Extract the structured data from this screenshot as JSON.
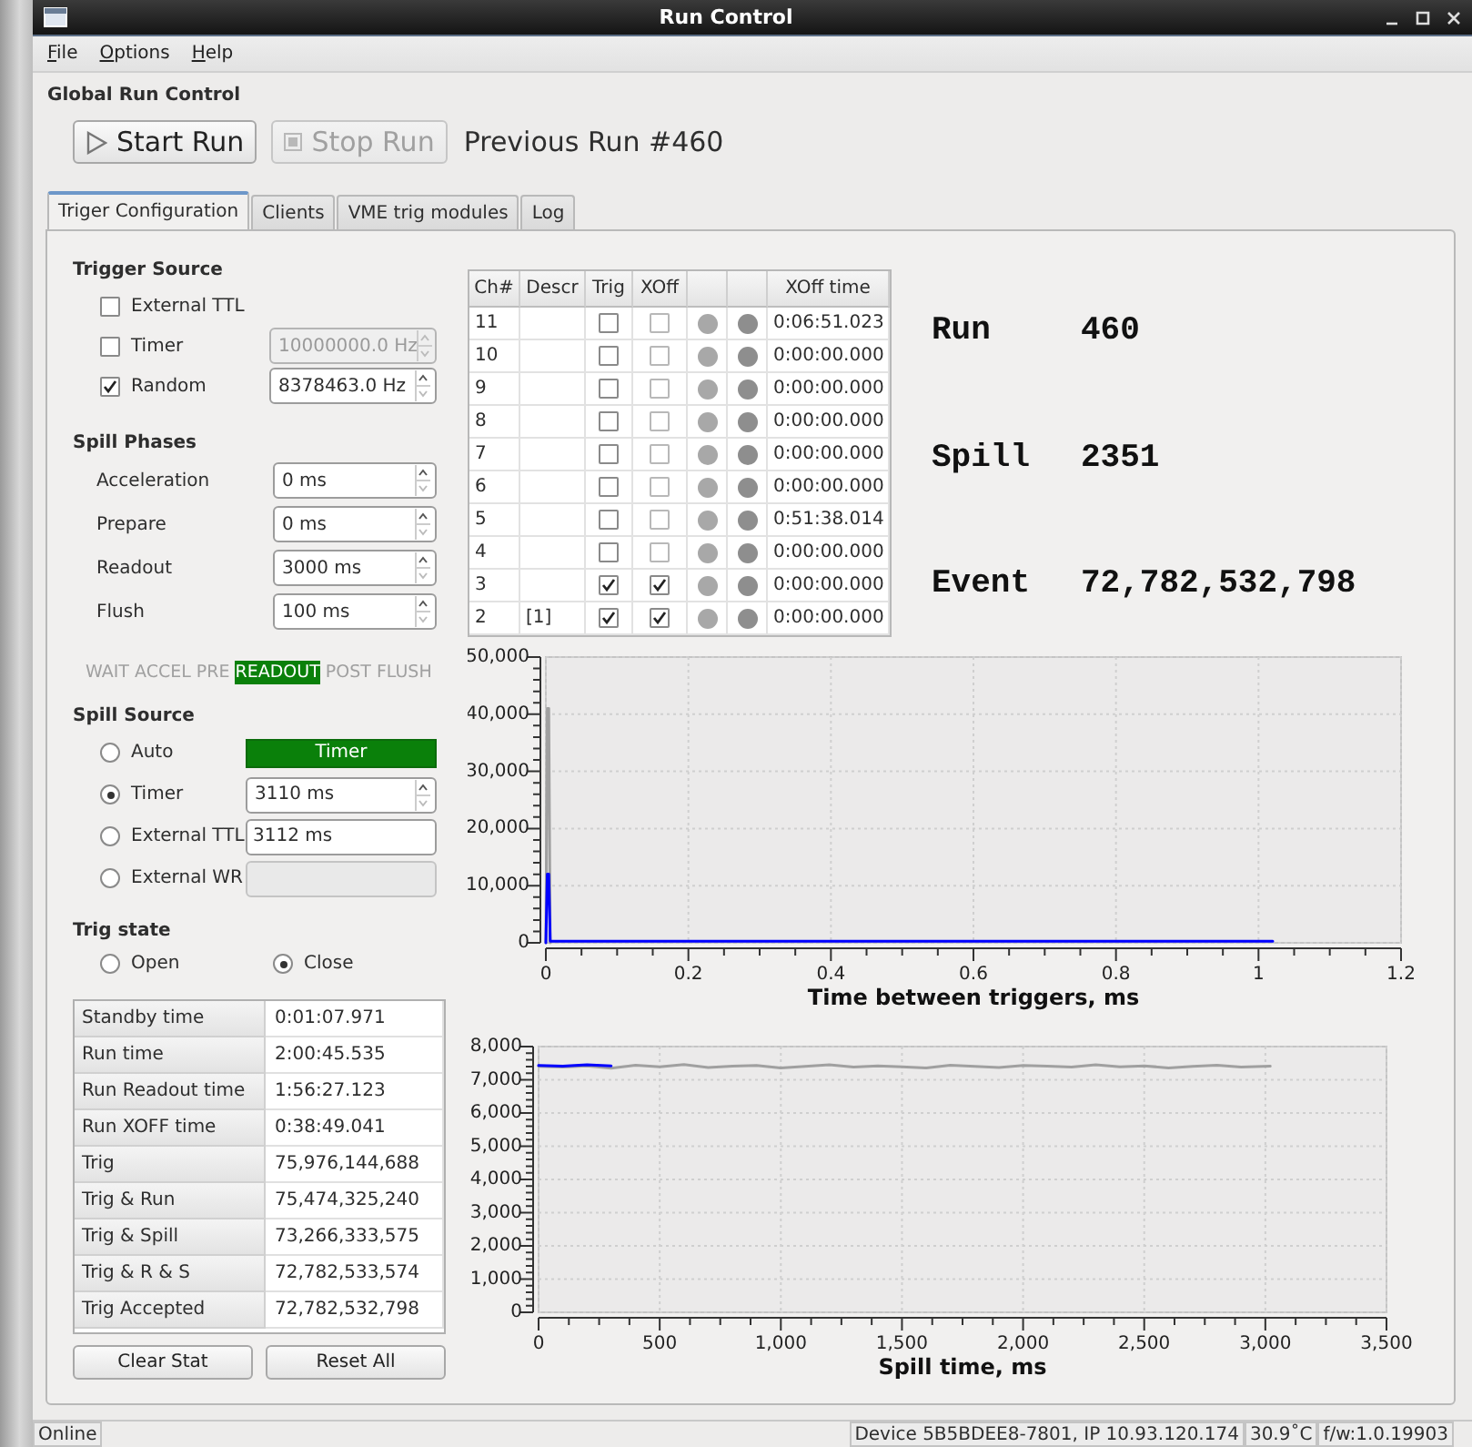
{
  "window": {
    "title": "Run Control"
  },
  "menu": [
    {
      "label": "File"
    },
    {
      "label": "Options"
    },
    {
      "label": "Help"
    }
  ],
  "global_run_control": {
    "title": "Global Run Control",
    "buttons": [
      {
        "label": "Start Run",
        "kind": "play",
        "disabled": false
      },
      {
        "label": "Stop Run",
        "kind": "stop",
        "disabled": true
      }
    ],
    "previous_run": "Previous Run #460"
  },
  "tabs": [
    {
      "label": "Triger Configuration",
      "selected": true
    },
    {
      "label": "Clients",
      "selected": false
    },
    {
      "label": "VME trig modules",
      "selected": false
    },
    {
      "label": "Log",
      "selected": false
    }
  ],
  "trigger_source": {
    "title": "Trigger Source",
    "items": [
      {
        "label": "External TTL",
        "checked": false
      },
      {
        "label": "Timer",
        "checked": false,
        "field": {
          "value": "10000000.0 Hz",
          "disabled": true
        }
      },
      {
        "label": "Random",
        "checked": true,
        "field": {
          "value": "8378463.0 Hz",
          "disabled": false
        }
      }
    ]
  },
  "spill_phases": {
    "title": "Spill Phases",
    "items": [
      {
        "label": "Acceleration",
        "value": "0 ms"
      },
      {
        "label": "Prepare",
        "value": "0 ms"
      },
      {
        "label": "Readout",
        "value": "3000 ms"
      },
      {
        "label": "Flush",
        "value": "100 ms"
      }
    ]
  },
  "phase_indicator": [
    {
      "label": "WAIT",
      "selected": false
    },
    {
      "label": "ACCEL",
      "selected": false
    },
    {
      "label": "PRE",
      "selected": false
    },
    {
      "label": "READOUT",
      "selected": true
    },
    {
      "label": "POST",
      "selected": false
    },
    {
      "label": "FLUSH",
      "selected": false
    }
  ],
  "spill_source": {
    "title": "Spill Source",
    "options": [
      {
        "label": "Auto",
        "selected": false,
        "kind": "indicator",
        "value": "Timer"
      },
      {
        "label": "Timer",
        "selected": true,
        "kind": "spin",
        "value": "3110 ms"
      },
      {
        "label": "External TTL",
        "selected": false,
        "kind": "text",
        "value": "3112 ms"
      },
      {
        "label": "External WR",
        "selected": false,
        "kind": "disabled"
      }
    ]
  },
  "trig_state": {
    "title": "Trig state",
    "options": [
      {
        "label": "Open",
        "selected": false
      },
      {
        "label": "Close",
        "selected": true
      }
    ]
  },
  "stats": [
    {
      "label": "Standby time",
      "value": "0:01:07.971"
    },
    {
      "label": "Run time",
      "value": "2:00:45.535"
    },
    {
      "label": "Run Readout time",
      "value": "1:56:27.123"
    },
    {
      "label": "Run XOFF time",
      "value": "0:38:49.041"
    },
    {
      "label": "Trig",
      "value": "75,976,144,688"
    },
    {
      "label": "Trig & Run",
      "value": "75,474,325,240"
    },
    {
      "label": "Trig & Spill",
      "value": "73,266,333,575"
    },
    {
      "label": "Trig & R & S",
      "value": "72,782,533,574"
    },
    {
      "label": "Trig Accepted",
      "value": "72,782,532,798"
    }
  ],
  "stat_buttons": [
    {
      "label": "Clear Stat"
    },
    {
      "label": "Reset All"
    }
  ],
  "channels": {
    "columns": [
      "Ch#",
      "Descr",
      "Trig",
      "XOff",
      "XOff time"
    ],
    "rows": [
      {
        "ch": "11",
        "trig": false,
        "xoff": false,
        "led_1": false,
        "led_2": false,
        "xoff_time": "0:06:51.023"
      },
      {
        "ch": "10",
        "trig": false,
        "xoff": false,
        "led_1": false,
        "led_2": false,
        "xoff_time": "0:00:00.000"
      },
      {
        "ch": "9",
        "trig": false,
        "xoff": false,
        "led_1": false,
        "led_2": false,
        "xoff_time": "0:00:00.000"
      },
      {
        "ch": "8",
        "trig": false,
        "xoff": false,
        "led_1": false,
        "led_2": false,
        "xoff_time": "0:00:00.000"
      },
      {
        "ch": "7",
        "trig": false,
        "xoff": false,
        "led_1": false,
        "led_2": false,
        "xoff_time": "0:00:00.000"
      },
      {
        "ch": "6",
        "trig": false,
        "xoff": false,
        "led_1": false,
        "led_2": false,
        "xoff_time": "0:00:00.000"
      },
      {
        "ch": "5",
        "trig": false,
        "xoff": false,
        "led_1": false,
        "led_2": false,
        "xoff_time": "0:51:38.014"
      },
      {
        "ch": "4",
        "trig": false,
        "xoff": false,
        "led_1": false,
        "led_2": false,
        "xoff_time": "0:00:00.000"
      },
      {
        "ch": "3",
        "trig": true,
        "xoff": true,
        "led_1": false,
        "led_2": false,
        "xoff_time": "0:00:00.000"
      },
      {
        "ch": "2",
        "descr": "[1]",
        "trig": true,
        "xoff": true,
        "led_1": false,
        "led_2": false,
        "xoff_time": "0:00:00.000"
      }
    ]
  },
  "readouts": [
    {
      "label": "Run",
      "value": "460"
    },
    {
      "label": "Spill",
      "value": "2351"
    },
    {
      "label": "Event",
      "value": "72,782,532,798"
    }
  ],
  "charts": [
    {
      "chart_data": {
        "type": "line",
        "xlabel": "Time between triggers, ms",
        "x": [
          0,
          0.002,
          0.004,
          0.006,
          0.5,
          1.02
        ],
        "series": [
          {
            "color": "#a0a0a0",
            "values": [
              0,
              41000,
              41000,
              0,
              null,
              null
            ]
          },
          {
            "color": "#0000ff",
            "values": [
              0,
              12000,
              12000,
              300,
              300,
              300
            ]
          }
        ],
        "xlim": [
          0,
          1.2
        ],
        "ylim": [
          0,
          50000
        ],
        "grid": true,
        "xticks": [
          0,
          0.2,
          0.4,
          0.6,
          0.8,
          1,
          1.2
        ],
        "yticks": [
          0,
          {
            "value": 10000,
            "label": "10,000"
          },
          {
            "value": 20000,
            "label": "20,000"
          },
          {
            "value": 30000,
            "label": "30,000"
          },
          {
            "value": 40000,
            "label": "40,000"
          },
          {
            "value": 50000,
            "label": "50,000"
          }
        ]
      }
    },
    {
      "chart_data": {
        "type": "line",
        "xlabel": "Spill time, ms",
        "x": [
          0,
          100,
          200,
          300,
          400,
          500,
          600,
          700,
          800,
          900,
          1000,
          1100,
          1200,
          1300,
          1400,
          1500,
          1600,
          1700,
          1800,
          1900,
          2000,
          2100,
          2200,
          2300,
          2400,
          2500,
          2600,
          2700,
          2800,
          2900,
          3020
        ],
        "series": [
          {
            "color": "#a0a0a0",
            "values": [
              7400,
              7380,
              7420,
              7350,
              7440,
              7390,
              7460,
              7370,
              7410,
              7430,
              7360,
              7400,
              7450,
              7380,
              7420,
              7390,
              7360,
              7440,
              7400,
              7370,
              7430,
              7410,
              7380,
              7450,
              7390,
              7420,
              7360,
              7400,
              7440,
              7380,
              7410
            ]
          },
          {
            "color": "#0000ff",
            "values": [
              7430,
              7410,
              7450,
              7420,
              null,
              null,
              null,
              null,
              null,
              null,
              null,
              null,
              null,
              null,
              null,
              null,
              null,
              null,
              null,
              null,
              null,
              null,
              null,
              null,
              null,
              null,
              null,
              null,
              null,
              null,
              null
            ]
          }
        ],
        "xlim": [
          0,
          3500
        ],
        "ylim": [
          0,
          8000
        ],
        "grid": true,
        "xticks": [
          0,
          500,
          {
            "value": 1000,
            "label": "1,000"
          },
          {
            "value": 1500,
            "label": "1,500"
          },
          {
            "value": 2000,
            "label": "2,000"
          },
          {
            "value": 2500,
            "label": "2,500"
          },
          {
            "value": 3000,
            "label": "3,000"
          },
          {
            "value": 3500,
            "label": "3,500"
          }
        ],
        "yticks": [
          0,
          {
            "value": 1000,
            "label": "1,000"
          },
          {
            "value": 2000,
            "label": "2,000"
          },
          {
            "value": 3000,
            "label": "3,000"
          },
          {
            "value": 4000,
            "label": "4,000"
          },
          {
            "value": 5000,
            "label": "5,000"
          },
          {
            "value": 6000,
            "label": "6,000"
          },
          {
            "value": 7000,
            "label": "7,000"
          },
          {
            "value": 8000,
            "label": "8,000"
          }
        ]
      }
    }
  ],
  "status_bar": {
    "status": "Online",
    "device": "Device 5B5BDEE8-7801, IP 10.93.120.174",
    "temperature": "30.9˚C",
    "firmware": "f/w:1.0.19903"
  }
}
